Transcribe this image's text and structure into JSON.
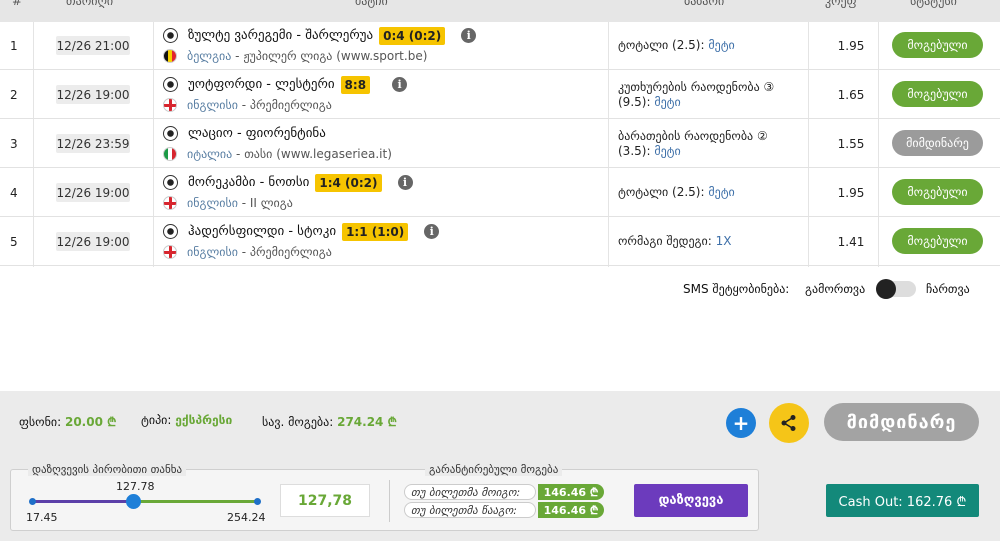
{
  "header": {
    "num": "#",
    "date": "თარიღი",
    "match": "მატჩი",
    "market": "ბაზარი",
    "odds": "კოეფ",
    "status": "სტატუსი"
  },
  "rows": [
    {
      "num": "1",
      "date": "12/26 21:00",
      "teams": "ზულტე ვარეგემი - შარლერუა",
      "score": "0:4 (0:2)",
      "country": "ბელგია",
      "league": " - ჟუპილერ ლიგა (www.sport.be)",
      "market_line1": "ტოტალი (2.5): ",
      "market_line2": "",
      "selection": "მეტი",
      "odds": "1.95",
      "status": "მოგებული",
      "flag": "be"
    },
    {
      "num": "2",
      "date": "12/26 19:00",
      "teams": "უოტფორდი - ლესტერი",
      "score": "8:8",
      "country": "ინგლისი",
      "league": " - პრემიერლიგა",
      "market_line1": "კუთხურების რაოდენობა ③",
      "market_line2": "(9.5): ",
      "selection": "მეტი",
      "odds": "1.65",
      "status": "მოგებული",
      "flag": "en"
    },
    {
      "num": "3",
      "date": "12/26 23:59",
      "teams": "ლაციო - ფიორენტინა",
      "score": "",
      "country": "იტალია",
      "league": " - თასი (www.legaseriea.it)",
      "market_line1": "ბარათების რაოდენობა ②",
      "market_line2": "(3.5): ",
      "selection": "მეტი",
      "odds": "1.55",
      "status": "მიმდინარე",
      "flag": "it"
    },
    {
      "num": "4",
      "date": "12/26 19:00",
      "teams": "მორეკამბი - ნოთსი",
      "score": "1:4 (0:2)",
      "country": "ინგლისი",
      "league": " - II ლიგა",
      "market_line1": "ტოტალი (2.5): ",
      "market_line2": "",
      "selection": "მეტი",
      "odds": "1.95",
      "status": "მოგებული",
      "flag": "en"
    },
    {
      "num": "5",
      "date": "12/26 19:00",
      "teams": "ჰადერსფილდი - სტოკი",
      "score": "1:1 (1:0)",
      "country": "ინგლისი",
      "league": " - პრემიერლიგა",
      "market_line1": "ორმაგი შედეგი: ",
      "market_line2": "",
      "selection": "1X",
      "odds": "1.41",
      "status": "მოგებული",
      "flag": "en"
    }
  ],
  "sms": {
    "label": "SMS შეტყობინება:",
    "off": "გამორთვა",
    "on": "ჩართვა"
  },
  "summary": {
    "stake_label": "ფსონი:",
    "stake_value": "20.00 ₾",
    "type_label": "ტიპი:",
    "type_value": "ექსპრესი",
    "win_label": "სავ. მოგება:",
    "win_value": "274.24 ₾",
    "plus": "+",
    "status_button": "მიმდინარე"
  },
  "insurance": {
    "title": "დაზღვევის პირობითი თანხა",
    "min": "17.45",
    "max": "254.24",
    "current": "127.78",
    "slider_fraction": 0.45,
    "input_value": "127,78",
    "guaranteed_title": "გარანტირებული მოგება",
    "if_win_label": "თუ ბილეთმა მოიგო:",
    "if_win_value": "146.46 ₾",
    "if_lose_label": "თუ ბილეთმა წააგო:",
    "if_lose_value": "146.46 ₾",
    "insure_button": "დაზღვევა",
    "cashout_button": "Cash Out: 162.76 ₾"
  },
  "colors": {
    "won": "#69a837",
    "pending": "#9b9b9b",
    "cashout": "#13897a",
    "insure": "#6c3bbd"
  }
}
